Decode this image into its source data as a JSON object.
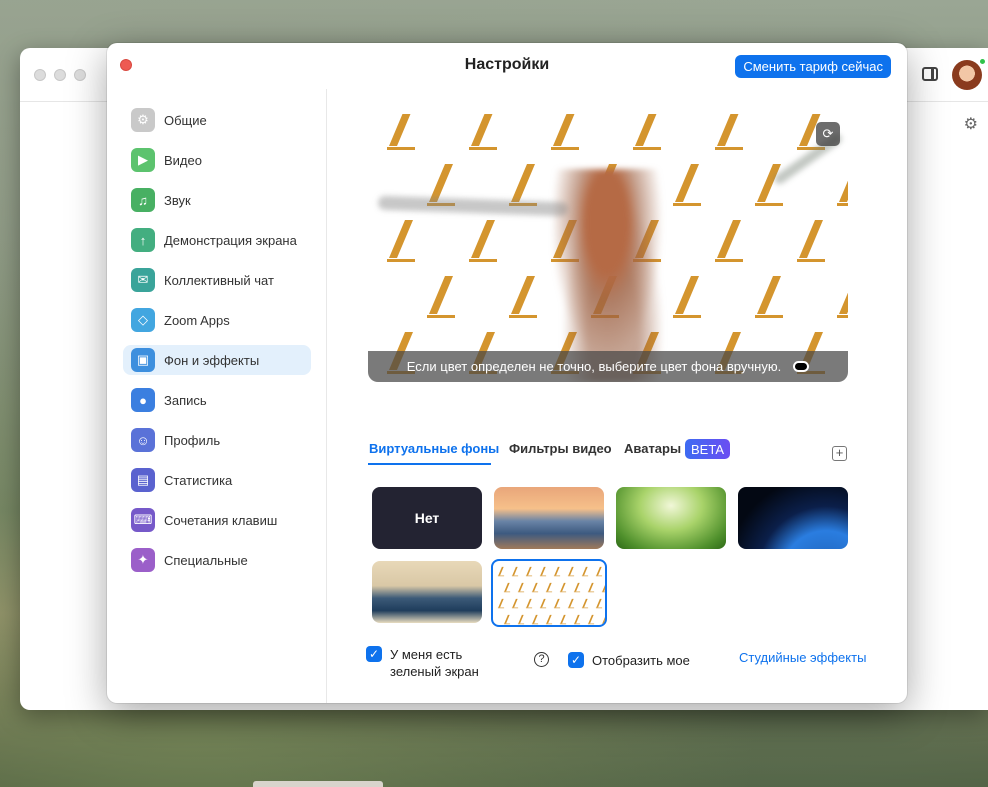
{
  "dialog": {
    "title": "Настройки",
    "upgrade_button": "Сменить тариф сейчас"
  },
  "sidebar": {
    "items": [
      {
        "label": "Общие",
        "icon": "gear-icon",
        "color": "#c9c9c9"
      },
      {
        "label": "Видео",
        "icon": "video-camera-icon",
        "color": "#5cc36e"
      },
      {
        "label": "Звук",
        "icon": "headphones-icon",
        "color": "#48b063"
      },
      {
        "label": "Демонстрация экрана",
        "icon": "share-screen-icon",
        "color": "#43ae80"
      },
      {
        "label": "Коллективный чат",
        "icon": "chat-bubbles-icon",
        "color": "#3aa49a"
      },
      {
        "label": "Zoom Apps",
        "icon": "apps-icon",
        "color": "#42a6e0"
      },
      {
        "label": "Фон и эффекты",
        "icon": "background-effects-icon",
        "color": "#3d8fde"
      },
      {
        "label": "Запись",
        "icon": "record-icon",
        "color": "#3b7fe0"
      },
      {
        "label": "Профиль",
        "icon": "profile-icon",
        "color": "#5a72d8"
      },
      {
        "label": "Статистика",
        "icon": "statistics-icon",
        "color": "#5a62cf"
      },
      {
        "label": "Сочетания клавиш",
        "icon": "keyboard-icon",
        "color": "#7659c9"
      },
      {
        "label": "Специальные",
        "icon": "accessibility-icon",
        "color": "#9b5fc9"
      }
    ],
    "active_index": 6
  },
  "preview": {
    "caption": "Если цвет определен не точно, выберите цвет фона вручную.",
    "rotate_icon": "rotate-icon"
  },
  "tabs": [
    {
      "label": "Виртуальные фоны",
      "active": true
    },
    {
      "label": "Фильтры видео",
      "active": false
    },
    {
      "label": "Аватары",
      "active": false
    }
  ],
  "beta_badge": "BETA",
  "add_icon": "plus-icon",
  "backgrounds": [
    {
      "label": "Нет",
      "kind": "none"
    },
    {
      "label": "",
      "kind": "golden-gate-bridge"
    },
    {
      "label": "",
      "kind": "grass"
    },
    {
      "label": "",
      "kind": "earth-from-space"
    },
    {
      "label": "",
      "kind": "great-wave"
    },
    {
      "label": "",
      "kind": "custom-logo-pattern",
      "selected": true
    }
  ],
  "options": {
    "green_screen": {
      "label_line1": "У меня есть",
      "label_line2": "зеленый экран",
      "checked": true
    },
    "mirror": {
      "label": "Отобразить мое",
      "checked": true
    },
    "studio_effects": "Студийные эффекты"
  },
  "colors": {
    "accent": "#0e72ed",
    "close": "#ee5a52",
    "logo_gold": "#d4952e"
  }
}
